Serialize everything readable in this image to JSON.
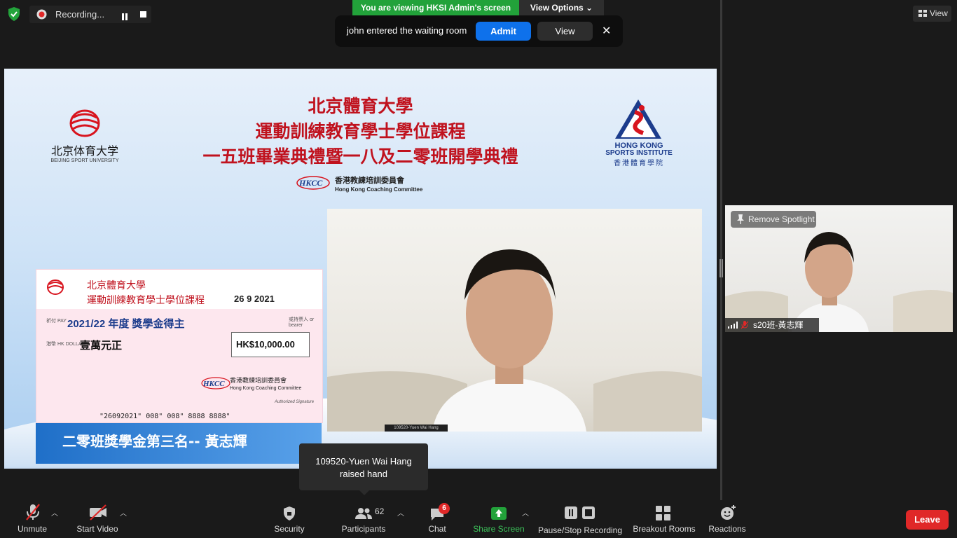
{
  "recording": {
    "label": "Recording..."
  },
  "banner": {
    "viewing": "You are viewing HKSI Admin's screen",
    "view_options": "View Options ⌄"
  },
  "notification": {
    "text": "john entered the waiting room",
    "admit": "Admit",
    "view": "View",
    "close": "✕"
  },
  "top_right": {
    "view": "View"
  },
  "slide": {
    "title_1": "北京體育大學",
    "title_2": "運動訓練教育學士學位課程",
    "title_3": "一五班畢業典禮暨一八及二零班開學典禮",
    "bsu_cn": "北京体育大学",
    "bsu_en": "BEIJING SPORT UNIVERSITY",
    "hksi_en_1": "HONG KONG",
    "hksi_en_2": "SPORTS INSTITUTE",
    "hksi_cn": "香港體育學院",
    "hkcc_cn": "香港教練培訓委員會",
    "hkcc_en": "Hong Kong Coaching Committee",
    "cheque": {
      "cn_1": "北京體育大學",
      "cn_2": "運動訓練教育學士學位課程",
      "date": "26   9   2021",
      "pay_label": "祈付 PAY",
      "payee": "2021/22 年度  獎學金得主",
      "bearer": "或持票人 or bearer",
      "hkd_label": "港幣 HK DOLLARS",
      "words": "壹萬元正",
      "amount": "HK$10,000.00",
      "hkcc_cn": "香港教練培訓委員會",
      "hkcc_en": "Hong Kong Coaching Committee",
      "signature": "Authorized Signature",
      "micr": "\"26092021\" 008\" 008\" 8888 8888\""
    },
    "caption": "二零班獎學金第三名-- 黃志輝",
    "presenter_name": "109520-Yuen Wai Hang"
  },
  "spotlight": {
    "remove": "Remove Spotlight",
    "name": "s20班-黃志輝"
  },
  "hand_tip": {
    "line_1": "109520-Yuen Wai Hang",
    "line_2": "raised hand"
  },
  "toolbar": {
    "unmute": "Unmute",
    "start_video": "Start Video",
    "security": "Security",
    "participants": "Participants",
    "participants_count": "62",
    "chat": "Chat",
    "chat_badge": "6",
    "share_screen": "Share Screen",
    "pause_recording": "Pause/Stop Recording",
    "breakout": "Breakout Rooms",
    "reactions": "Reactions",
    "leave": "Leave"
  },
  "colors": {
    "share_green": "#22a23a",
    "admit_blue": "#0e71eb",
    "leave_red": "#e02828"
  }
}
